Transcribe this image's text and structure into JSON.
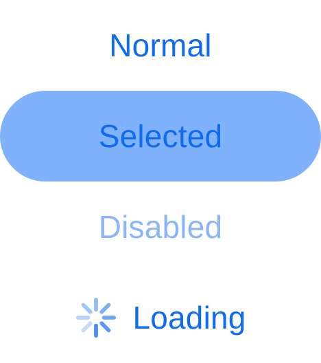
{
  "colors": {
    "accent": "#0F6BF0",
    "selected_background": "#80B2FC",
    "disabled_text": "#8AB6F7",
    "spinner": "#4A8FF3"
  },
  "buttons": {
    "normal_label": "Normal",
    "selected_label": "Selected",
    "disabled_label": "Disabled",
    "loading_label": "Loading",
    "loading_icon": "spinner-icon"
  }
}
